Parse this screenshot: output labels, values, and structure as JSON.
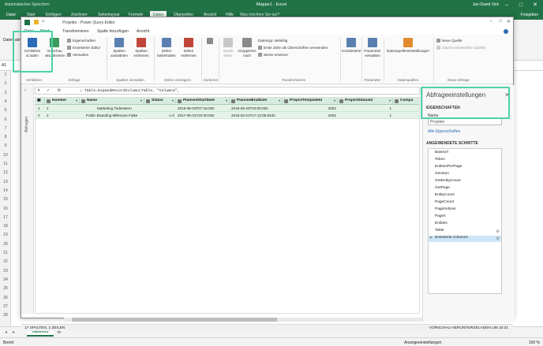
{
  "excel": {
    "title": "Mappe1 - Excel",
    "autosave": "Automatisches Speichern",
    "user": "Jan-David Vick",
    "tabs": [
      "Datei",
      "Start",
      "Einfügen",
      "Zeichnen",
      "Seitenlayout",
      "Formeln",
      "Daten",
      "Überprüfen",
      "Ansicht",
      "Hilfe"
    ],
    "active_tab": "Daten",
    "search": "Was möchten Sie tun?",
    "share": "Freigeben",
    "data_btn": "Daten abrufen",
    "namebox": "A1",
    "sheet": "Tabelle1",
    "ready": "Bereit",
    "display": "Anzeigeeinstellungen",
    "zoom": "100 %",
    "rows": [
      "1",
      "2",
      "3",
      "4",
      "5",
      "6",
      "7",
      "8",
      "9",
      "10",
      "11",
      "12",
      "13",
      "14",
      "15",
      "16",
      "17",
      "18",
      "19",
      "20",
      "21",
      "22",
      "23",
      "24",
      "25",
      "26",
      "27",
      "28"
    ]
  },
  "pq": {
    "title": "Projekte - Power Query-Editor",
    "tabs": [
      "Datei",
      "Start",
      "Transformieren",
      "Spalte hinzufügen",
      "Ansicht"
    ],
    "active_tab": "Start",
    "ribbon": {
      "close_load": "Schließen & laden",
      "preview": "Vorschau aktualisieren",
      "props": "Eigenschaften",
      "adv_editor": "Erweiterter Editor",
      "manage": "Verwalten",
      "choose_cols": "Spalten auswählen",
      "remove_cols": "Spalten entfernen",
      "keep_rows": "Zeilen beibehalten",
      "remove_rows": "Zeilen entfernen",
      "split": "Spalte teilen",
      "group": "Gruppieren nach",
      "datatype": "Datentyp: Beliebig",
      "first_row": "Erste Zeile als Überschriften verwenden",
      "replace": "Werte ersetzen",
      "combine": "Kombinieren",
      "params": "Parameter verwalten",
      "ds_settings": "Datenquelleneinstellungen",
      "new_source": "Neue Quelle",
      "recent": "Zuletzt verwendete Quellen",
      "g_close": "Schließen",
      "g_query": "Abfrage",
      "g_cols": "Spalten verwalten",
      "g_rows": "Zeilen verringern",
      "g_sort": "Sortieren",
      "g_transform": "Transformieren",
      "g_param": "Parameter",
      "g_ds": "Datenquellen",
      "g_new": "Neue Abfrage"
    },
    "formula": "= Table.ExpandRecordColumn(Table, \"Column1\",",
    "queries_label": "Abfragen",
    "columns": [
      "Number",
      "Name",
      "Status",
      "PlannedStartDate",
      "PlannedEndDate",
      "ProjectTemplateId",
      "ProjectStatusId",
      "Compa"
    ],
    "rows": [
      [
        "1",
        "1",
        "Marketing Todesstern",
        "",
        "2018-05-03T07:15:002",
        "2018-09-20T20:00:002",
        "2002",
        "1"
      ],
      [
        "2",
        "2",
        "Public Branding Millenium Falke",
        "null",
        "2017-05-31T22:00:002",
        "2019-02-01T17:13:08.8332",
        "2002",
        "1"
      ]
    ],
    "status_left": "17 SPALTEN, 2 ZEILEN",
    "status_right": "VORSCHAU HERUNTERGELADEN UM 10:31",
    "settings": {
      "title": "Abfrageeinstellungen",
      "props_hdr": "EIGENSCHAFTEN",
      "name_lbl": "Name",
      "name_val": "Projekte",
      "all_props": "Alle Eigenschaften",
      "steps_hdr": "ANGEWENDETE SCHRITTE",
      "steps": [
        "BaseUrl",
        "Token",
        "EntitiesPerPage",
        "GetJson",
        "GetEntityCount",
        "GetPage",
        "EntityCount",
        "PageCount",
        "PageIndices",
        "Pages",
        "Entities",
        "Table",
        "Erweiterte Column1"
      ],
      "selected_step": "Erweiterte Column1"
    }
  },
  "colors": {
    "excel_green": "#217346",
    "highlight": "#4fd0a9",
    "header_bg": "#d7ece0",
    "row_bg": "#e4f3e8"
  }
}
